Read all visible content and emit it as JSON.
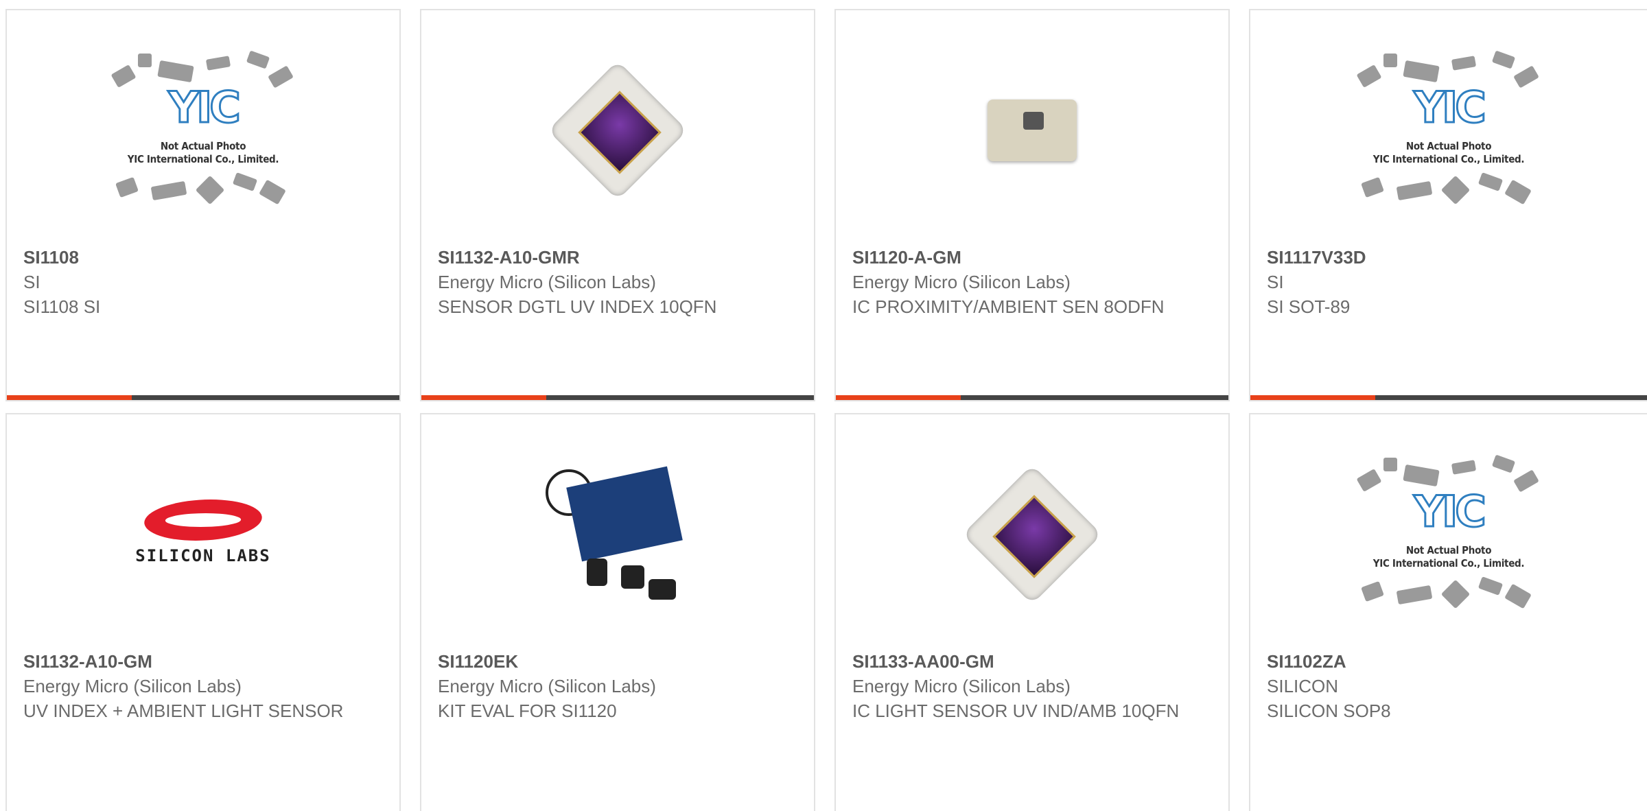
{
  "colors": {
    "accent": "#e8411a",
    "bar": "#444444",
    "part": "#595959",
    "text": "#6b6b6b"
  },
  "placeholder": {
    "logo": "YIC",
    "line1": "Not Actual Photo",
    "line2": "YIC International Co., Limited."
  },
  "silicon_labs_logo_text": "SILICON LABS",
  "products": [
    {
      "part": "SI1108",
      "maker": "SI",
      "desc": "SI1108 SI",
      "image": "placeholder-photo"
    },
    {
      "part": "SI1132-A10-GMR",
      "maker": "Energy Micro (Silicon Labs)",
      "desc": "SENSOR DGTL UV INDEX 10QFN",
      "image": "sensor-chip-photo"
    },
    {
      "part": "SI1120-A-GM",
      "maker": "Energy Micro (Silicon Labs)",
      "desc": "IC PROXIMITY/AMBIENT SEN 8ODFN",
      "image": "proximity-chip-photo"
    },
    {
      "part": "SI1117V33D",
      "maker": "SI",
      "desc": "SI SOT-89",
      "image": "placeholder-photo"
    },
    {
      "part": "SI1132-A10-GM",
      "maker": "Energy Micro (Silicon Labs)",
      "desc": "UV INDEX + AMBIENT LIGHT SENSOR",
      "image": "silicon-labs-logo"
    },
    {
      "part": "SI1120EK",
      "maker": "Energy Micro (Silicon Labs)",
      "desc": "KIT EVAL FOR SI1120",
      "image": "eval-kit-photo"
    },
    {
      "part": "SI1133-AA00-GM",
      "maker": "Energy Micro (Silicon Labs)",
      "desc": "IC LIGHT SENSOR UV IND/AMB 10QFN",
      "image": "sensor-chip-photo"
    },
    {
      "part": "SI1102ZA",
      "maker": "SILICON",
      "desc": "SILICON SOP8",
      "image": "placeholder-photo"
    }
  ]
}
